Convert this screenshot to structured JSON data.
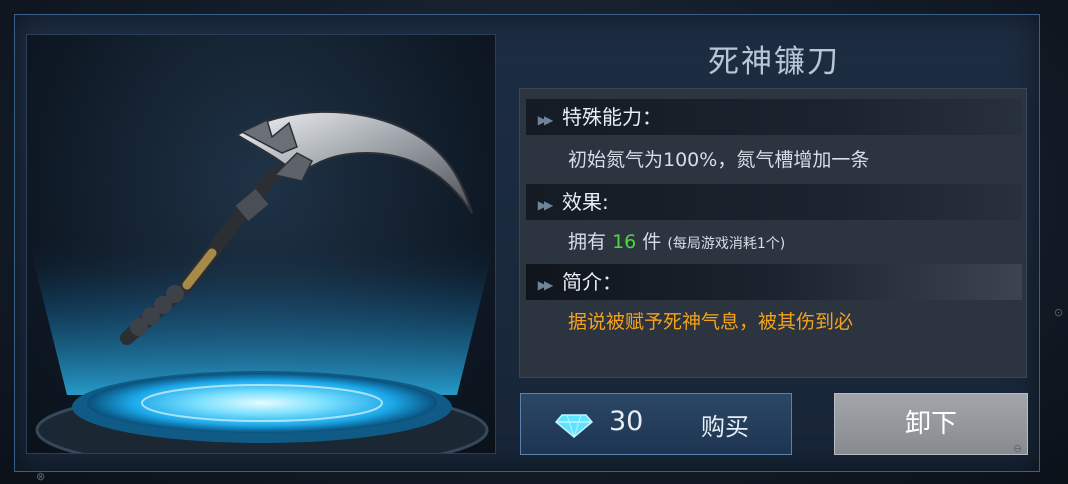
{
  "item": {
    "name": "死神镰刀",
    "ability_label": "特殊能力：",
    "ability_text": "初始氮气为100%，氮气槽增加一条",
    "effect_label": "效果:",
    "owned_prefix": "拥有",
    "owned_count": "16",
    "owned_suffix": "件",
    "owned_note": "(每局游戏消耗1个)",
    "intro_label": "简介：",
    "intro_text": "据说被赋予死神气息，被其伤到必"
  },
  "buy": {
    "price": "30",
    "label": "购买",
    "icon": "diamond-icon"
  },
  "unequip": {
    "label": "卸下"
  },
  "colors": {
    "accent_green": "#4dd93c",
    "intro_orange": "#f4a21c",
    "platform_glow": "#2fc6ff"
  }
}
